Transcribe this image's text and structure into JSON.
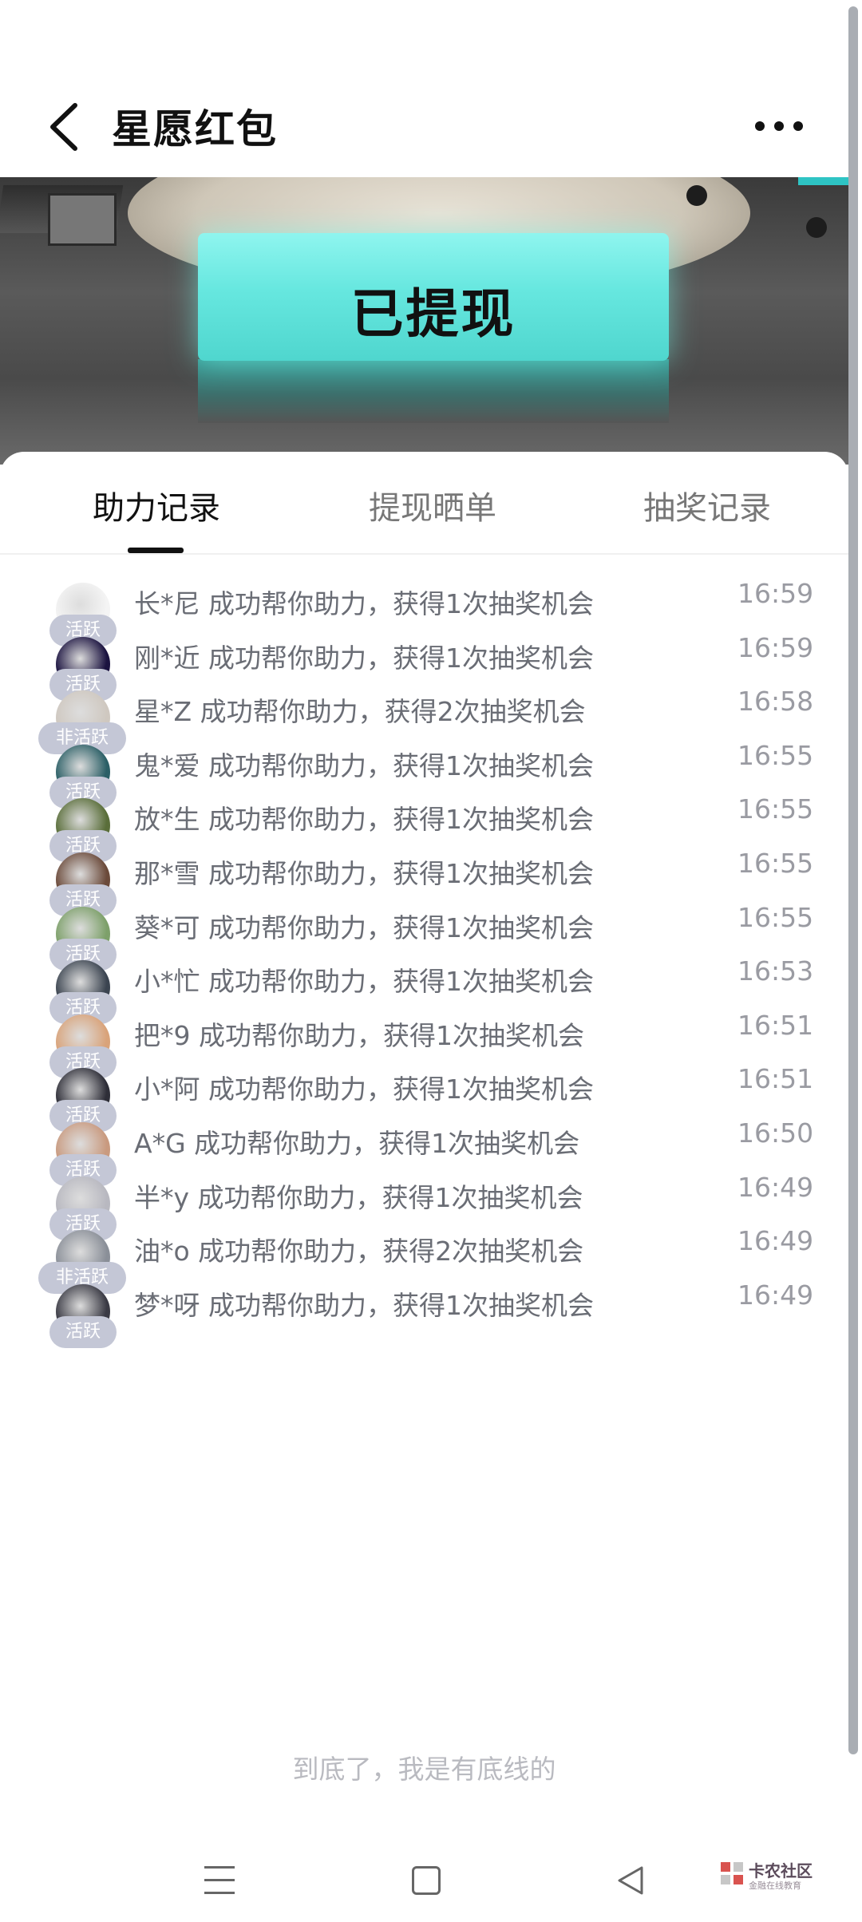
{
  "header": {
    "title": "星愿红包"
  },
  "banner": {
    "stamp_text": "已提现"
  },
  "tabs": [
    {
      "label": "助力记录",
      "active": true
    },
    {
      "label": "提现晒单",
      "active": false
    },
    {
      "label": "抽奖记录",
      "active": false
    }
  ],
  "records": [
    {
      "badge": "活跃",
      "status": "active",
      "text": "长*尼 成功帮你助力，获得1次抽奖机会",
      "time": "16:59",
      "avatar_color": "#f4f4f4"
    },
    {
      "badge": "活跃",
      "status": "active",
      "text": "刚*近 成功帮你助力，获得1次抽奖机会",
      "time": "16:59",
      "avatar_color": "#1b1340"
    },
    {
      "badge": "非活跃",
      "status": "inactive",
      "text": "星*Z 成功帮你助力，获得2次抽奖机会",
      "time": "16:58",
      "avatar_color": "#cfc8c0"
    },
    {
      "badge": "活跃",
      "status": "active",
      "text": "鬼*爱 成功帮你助力，获得1次抽奖机会",
      "time": "16:55",
      "avatar_color": "#2b5f66"
    },
    {
      "badge": "活跃",
      "status": "active",
      "text": "放*生 成功帮你助力，获得1次抽奖机会",
      "time": "16:55",
      "avatar_color": "#5a6e3a"
    },
    {
      "badge": "活跃",
      "status": "active",
      "text": "那*雪 成功帮你助力，获得1次抽奖机会",
      "time": "16:55",
      "avatar_color": "#6b4a3a"
    },
    {
      "badge": "活跃",
      "status": "active",
      "text": "葵*可 成功帮你助力，获得1次抽奖机会",
      "time": "16:55",
      "avatar_color": "#7da06a"
    },
    {
      "badge": "活跃",
      "status": "active",
      "text": "小*忙 成功帮你助力，获得1次抽奖机会",
      "time": "16:53",
      "avatar_color": "#3b4450"
    },
    {
      "badge": "活跃",
      "status": "active",
      "text": "把*9 成功帮你助力，获得1次抽奖机会",
      "time": "16:51",
      "avatar_color": "#d9a37a"
    },
    {
      "badge": "活跃",
      "status": "active",
      "text": "小*阿 成功帮你助力，获得1次抽奖机会",
      "time": "16:51",
      "avatar_color": "#2e2e38"
    },
    {
      "badge": "活跃",
      "status": "active",
      "text": "A*G 成功帮你助力，获得1次抽奖机会",
      "time": "16:50",
      "avatar_color": "#c99a7f"
    },
    {
      "badge": "活跃",
      "status": "active",
      "text": "半*y 成功帮你助力，获得1次抽奖机会",
      "time": "16:49",
      "avatar_color": "#b8b8c0"
    },
    {
      "badge": "非活跃",
      "status": "inactive",
      "text": "油*o 成功帮你助力，获得2次抽奖机会",
      "time": "16:49",
      "avatar_color": "#8a8f98"
    },
    {
      "badge": "活跃",
      "status": "active",
      "text": "梦*呀 成功帮你助力，获得1次抽奖机会",
      "time": "16:49",
      "avatar_color": "#3a3a44"
    }
  ],
  "footer": {
    "end_text": "到底了，我是有底线的"
  },
  "watermark": {
    "name": "卡农社区",
    "sub": "金融在线教育"
  },
  "icons": {
    "back": "back-chevron-icon",
    "more": "more-dots-icon",
    "nav_menu": "menu-lines-icon",
    "nav_home": "square-home-icon",
    "nav_back": "triangle-back-icon"
  }
}
